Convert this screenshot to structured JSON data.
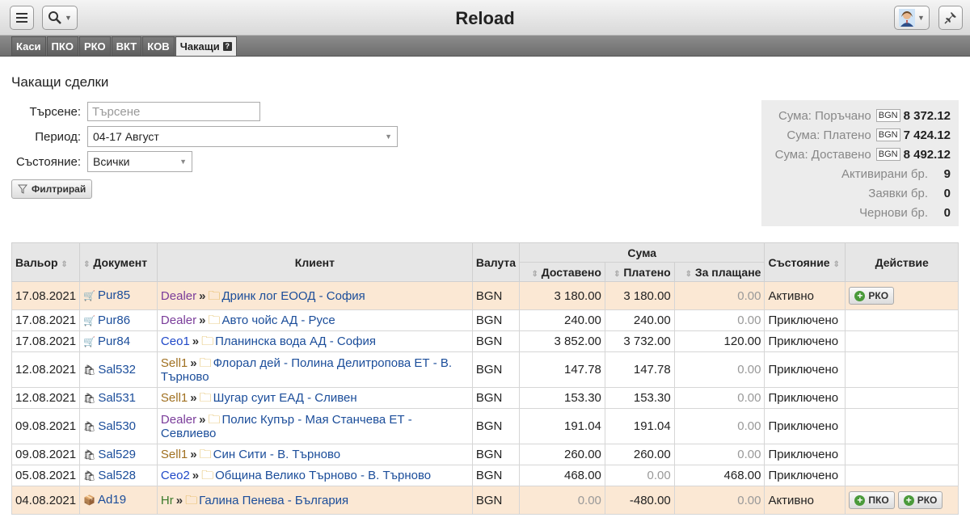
{
  "header": {
    "title": "Reload",
    "menu_icon": "hamburger-icon",
    "search_icon": "search-icon",
    "avatar_icon": "user-avatar-icon",
    "pin_icon": "pin-icon"
  },
  "tabs": [
    {
      "label": "Каси"
    },
    {
      "label": "ПКО"
    },
    {
      "label": "РКО"
    },
    {
      "label": "ВКТ"
    },
    {
      "label": "КОВ"
    },
    {
      "label": "Чакащи",
      "active": true
    }
  ],
  "page_title": "Чакащи сделки",
  "filters": {
    "search_label": "Търсене:",
    "search_placeholder": "Търсене",
    "period_label": "Период:",
    "period_value": "04-17 Август",
    "status_label": "Състояние:",
    "status_value": "Всички",
    "filter_button": "Филтрирай"
  },
  "summary": {
    "ordered_label": "Сума: Поръчано",
    "ordered_currency": "BGN",
    "ordered_value": "8 372.12",
    "paid_label": "Сума: Платено",
    "paid_currency": "BGN",
    "paid_value": "7 424.12",
    "delivered_label": "Сума: Доставено",
    "delivered_currency": "BGN",
    "delivered_value": "8 492.12",
    "activated_label": "Активирани бр.",
    "activated_value": "9",
    "requests_label": "Заявки бр.",
    "requests_value": "0",
    "drafts_label": "Чернови бр.",
    "drafts_value": "0"
  },
  "table": {
    "col_valor": "Вальор",
    "col_document": "Документ",
    "col_client": "Клиент",
    "col_currency": "Валута",
    "col_sum": "Сума",
    "col_delivered": "Доставено",
    "col_paid": "Платено",
    "col_topay": "За плащане",
    "col_status": "Състояние",
    "col_action": "Действие",
    "rows": [
      {
        "date": "17.08.2021",
        "doc": "Pur85",
        "role": "Dealer",
        "client": "Дринк лог ЕООД - София",
        "currency": "BGN",
        "delivered": "3 180.00",
        "paid": "3 180.00",
        "topay": "0.00",
        "status": "Активно",
        "btn1": "РКО",
        "btn2": ""
      },
      {
        "date": "17.08.2021",
        "doc": "Pur86",
        "role": "Dealer",
        "client": "Авто чойс АД - Русе",
        "currency": "BGN",
        "delivered": "240.00",
        "paid": "240.00",
        "topay": "0.00",
        "status": "Приключено",
        "btn1": "",
        "btn2": ""
      },
      {
        "date": "17.08.2021",
        "doc": "Pur84",
        "role": "Ceo1",
        "client": "Планинска вода АД - София",
        "currency": "BGN",
        "delivered": "3 852.00",
        "paid": "3 732.00",
        "topay": "120.00",
        "status": "Приключено",
        "btn1": "",
        "btn2": ""
      },
      {
        "date": "12.08.2021",
        "doc": "Sal532",
        "role": "Sell1",
        "client": "Флорал дей - Полина Делитропова ЕТ - В. Търново",
        "currency": "BGN",
        "delivered": "147.78",
        "paid": "147.78",
        "topay": "0.00",
        "status": "Приключено",
        "btn1": "",
        "btn2": ""
      },
      {
        "date": "12.08.2021",
        "doc": "Sal531",
        "role": "Sell1",
        "client": "Шугар суит ЕАД - Сливен",
        "currency": "BGN",
        "delivered": "153.30",
        "paid": "153.30",
        "topay": "0.00",
        "status": "Приключено",
        "btn1": "",
        "btn2": ""
      },
      {
        "date": "09.08.2021",
        "doc": "Sal530",
        "role": "Dealer",
        "client": "Полис Купър - Мая Станчева ЕТ - Севлиево",
        "currency": "BGN",
        "delivered": "191.04",
        "paid": "191.04",
        "topay": "0.00",
        "status": "Приключено",
        "btn1": "",
        "btn2": ""
      },
      {
        "date": "09.08.2021",
        "doc": "Sal529",
        "role": "Sell1",
        "client": "Син Сити - В. Търново",
        "currency": "BGN",
        "delivered": "260.00",
        "paid": "260.00",
        "topay": "0.00",
        "status": "Приключено",
        "btn1": "",
        "btn2": ""
      },
      {
        "date": "05.08.2021",
        "doc": "Sal528",
        "role": "Ceo2",
        "client": "Община Велико Търново - В. Търново",
        "currency": "BGN",
        "delivered": "468.00",
        "paid": "0.00",
        "topay": "468.00",
        "status": "Приключено",
        "btn1": "",
        "btn2": ""
      },
      {
        "date": "04.08.2021",
        "doc": "Ad19",
        "role": "Hr",
        "client": "Галина Пенева - България",
        "currency": "BGN",
        "delivered": "0.00",
        "paid": "-480.00",
        "topay": "0.00",
        "status": "Активно",
        "btn1": "ПКО",
        "btn2": "РКО"
      }
    ]
  }
}
